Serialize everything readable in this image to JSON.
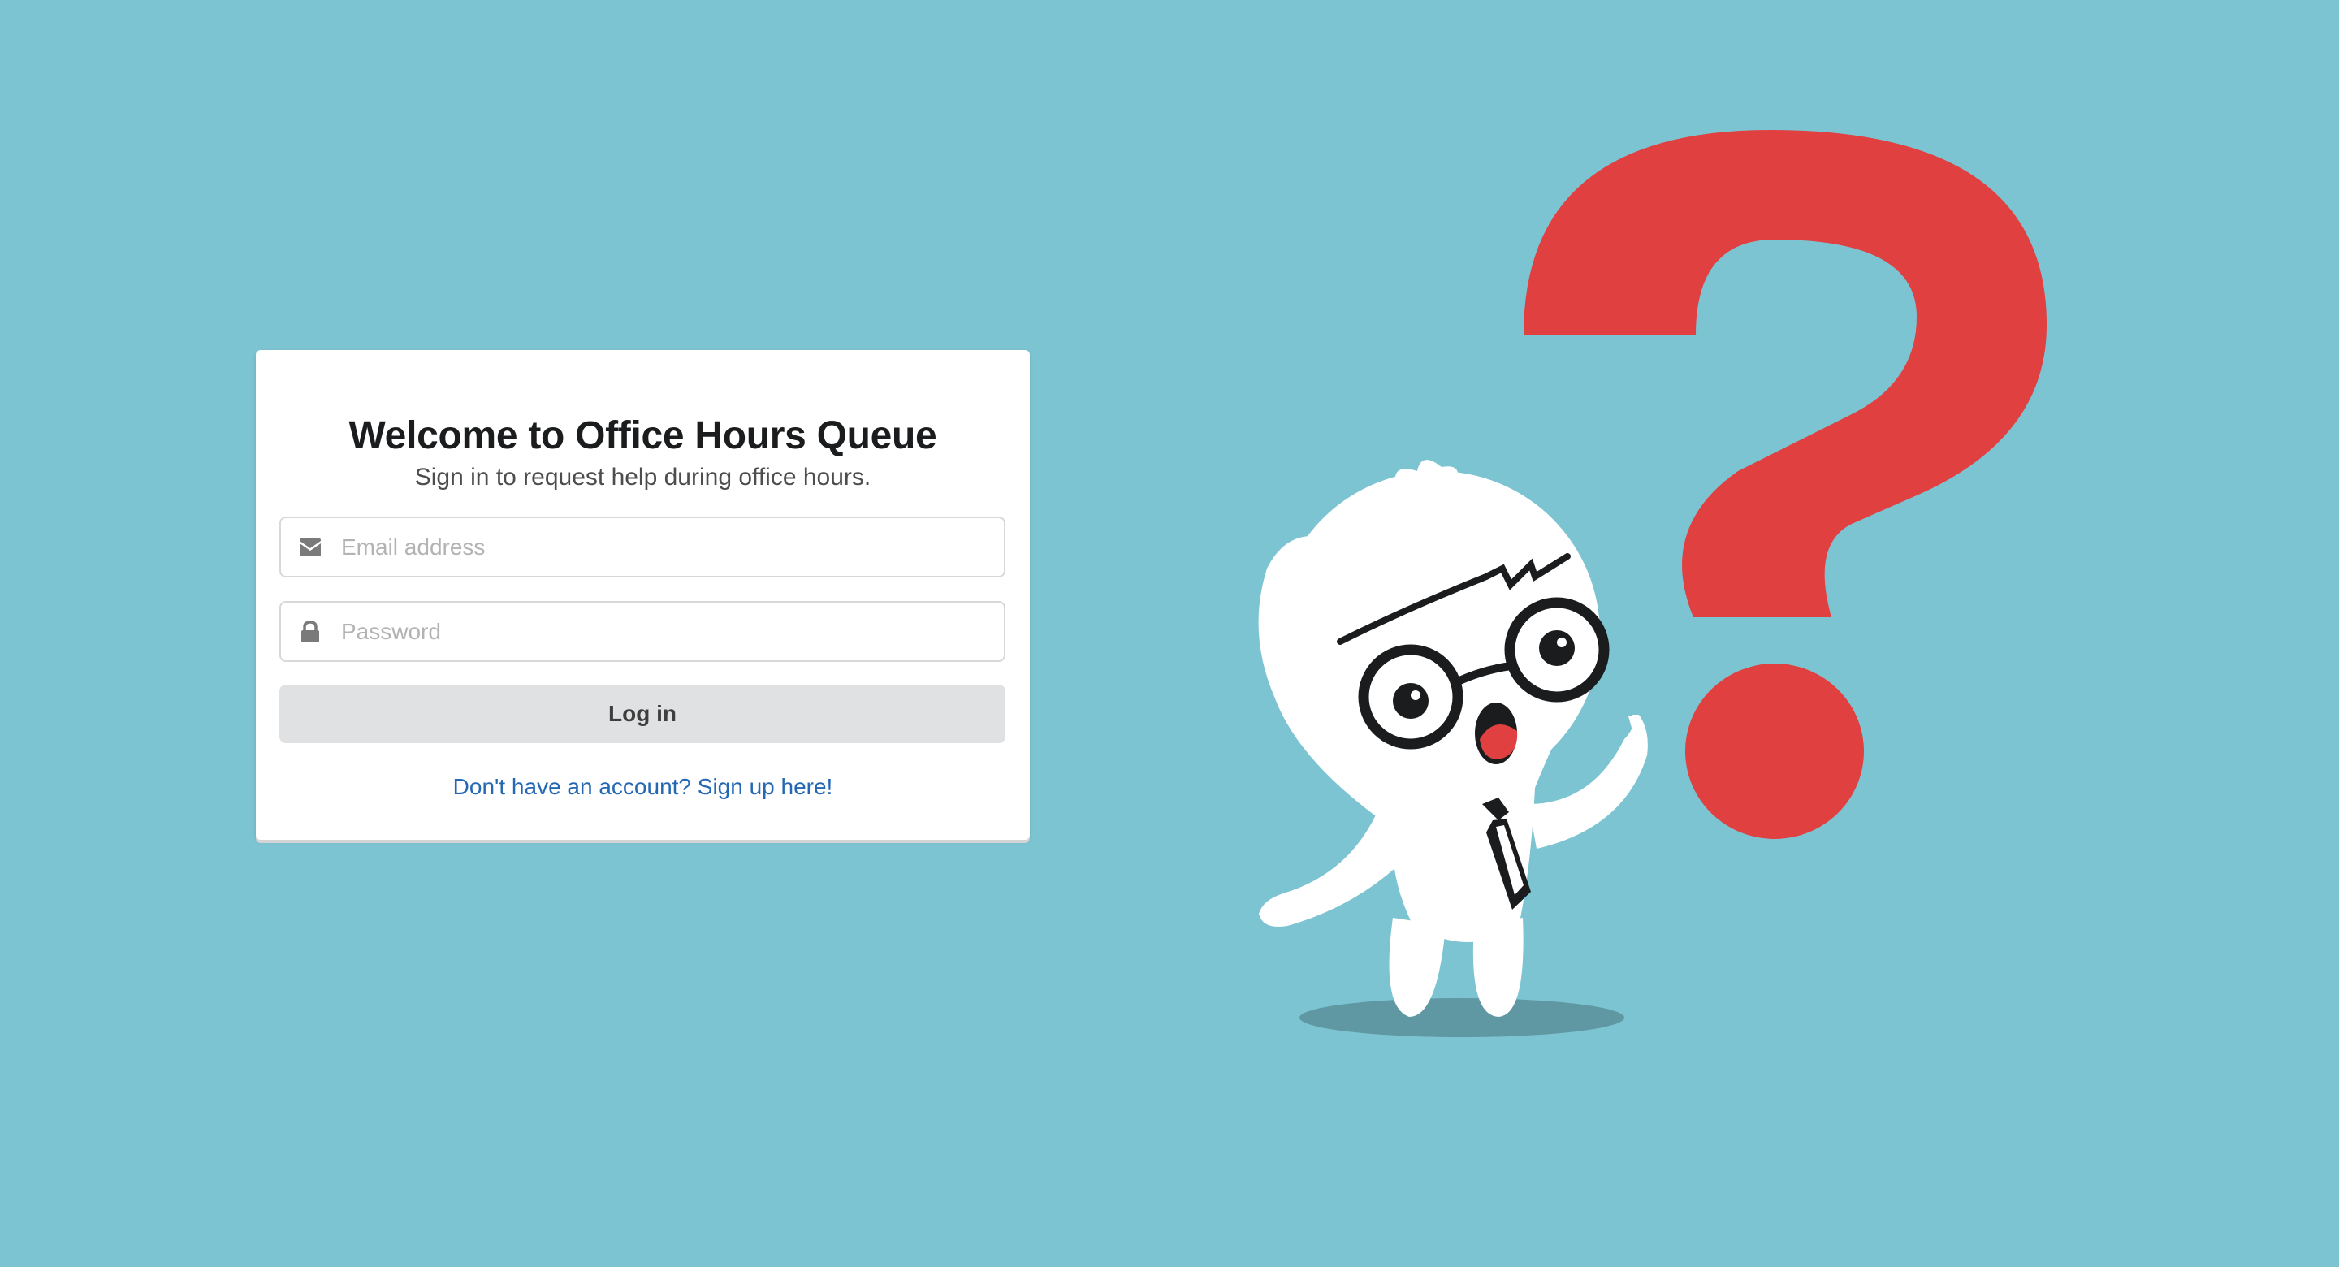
{
  "login": {
    "title": "Welcome to Office Hours Queue",
    "subtitle": "Sign in to request help during office hours.",
    "email": {
      "placeholder": "Email address",
      "value": "",
      "icon": "envelope-icon"
    },
    "password": {
      "placeholder": "Password",
      "value": "",
      "icon": "lock-icon"
    },
    "login_label": "Log in",
    "signup_link": "Don't have an account? Sign up here!"
  },
  "colors": {
    "background": "#7dc4d3",
    "question_mark": "#e04040",
    "link": "#2468b4",
    "button": "#e0e1e2"
  }
}
